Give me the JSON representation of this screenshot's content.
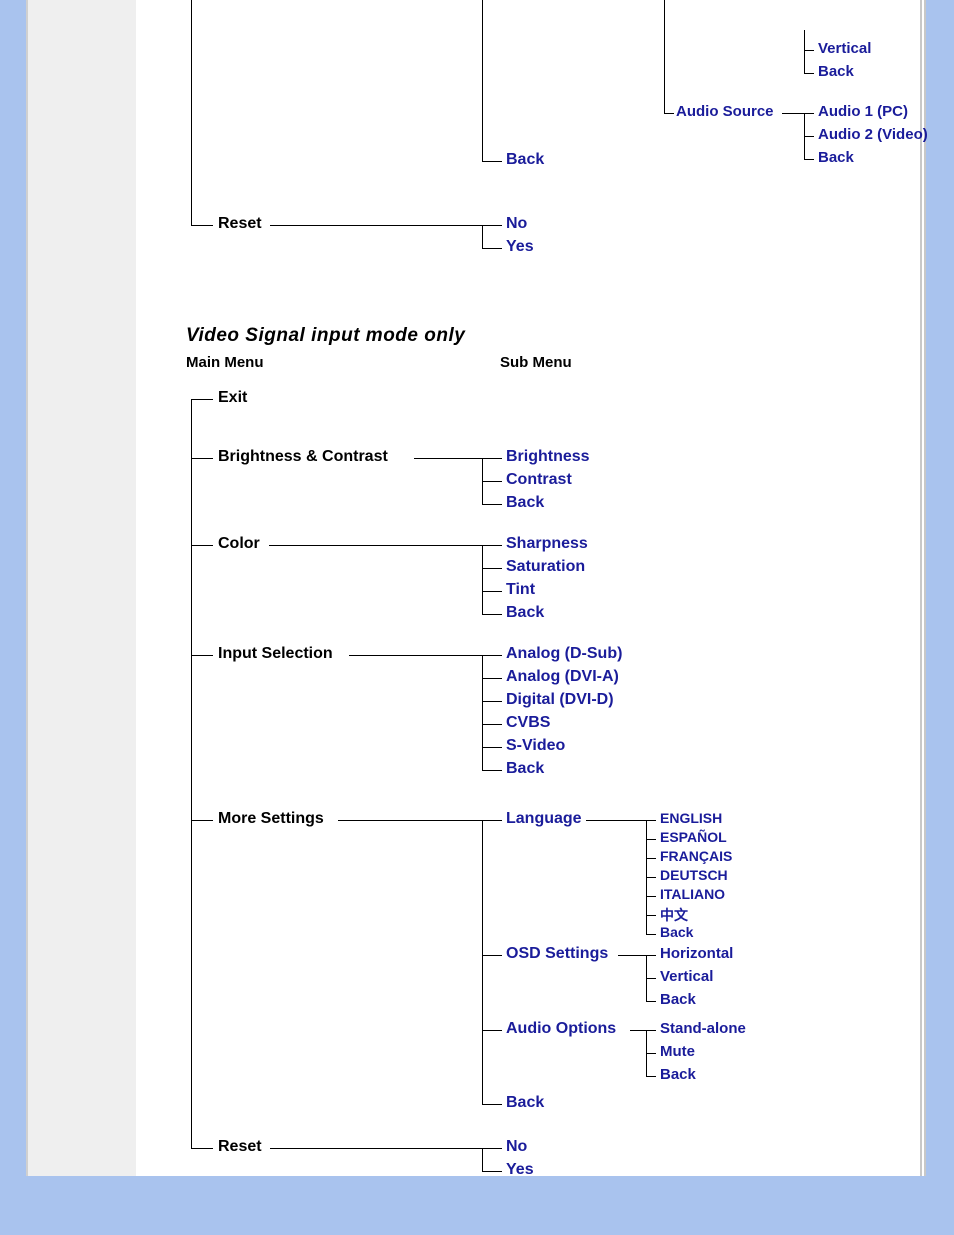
{
  "top": {
    "vertical": "Vertical",
    "back_vh": "Back",
    "audio_source": "Audio Source",
    "audio1": "Audio 1 (PC)",
    "audio2": "Audio 2 (Video)",
    "back_audio": "Back",
    "back_more": "Back",
    "reset": "Reset",
    "no": "No",
    "yes": "Yes"
  },
  "video": {
    "heading": "Video  Signal  input  mode  only",
    "main_menu": "Main Menu",
    "sub_menu": "Sub Menu",
    "exit": "Exit",
    "brightness_contrast": "Brightness & Contrast",
    "bc_sub": {
      "brightness": "Brightness",
      "contrast": "Contrast",
      "back": "Back"
    },
    "color": "Color",
    "color_sub": {
      "sharpness": "Sharpness",
      "saturation": "Saturation",
      "tint": "Tint",
      "back": "Back"
    },
    "input_sel": "Input Selection",
    "input_sub": {
      "a1": "Analog (D-Sub)",
      "a2": "Analog (DVI-A)",
      "a3": "Digital (DVI-D)",
      "a4": "CVBS",
      "a5": "S-Video",
      "a6": "Back"
    },
    "more": "More Settings",
    "more_sub": {
      "language": "Language",
      "lang_items": {
        "en": "ENGLISH",
        "es": "ESPAÑOL",
        "fr": "FRANÇAIS",
        "de": "DEUTSCH",
        "it": "ITALIANO",
        "zh": "中文",
        "back": "Back"
      },
      "osd": "OSD Settings",
      "osd_items": {
        "h": "Horizontal",
        "v": "Vertical",
        "back": "Back"
      },
      "audio": "Audio Options",
      "audio_items": {
        "sa": "Stand-alone",
        "mute": "Mute",
        "back": "Back"
      },
      "back": "Back"
    },
    "reset": "Reset",
    "reset_sub": {
      "no": "No",
      "yes": "Yes"
    }
  }
}
